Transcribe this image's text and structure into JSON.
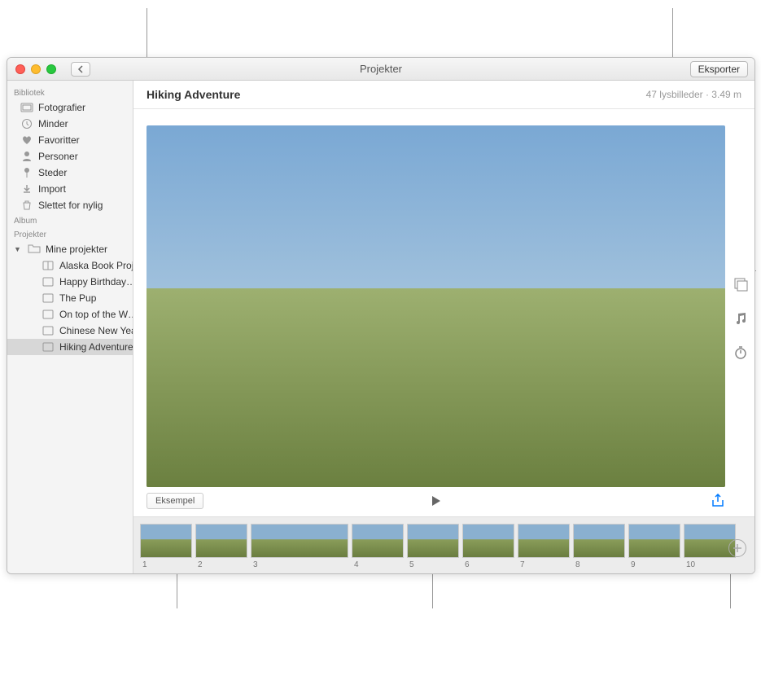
{
  "window": {
    "title": "Projekter",
    "export_label": "Eksporter"
  },
  "sidebar": {
    "sections": {
      "library_label": "Bibliotek",
      "album_label": "Album",
      "projects_label": "Projekter"
    },
    "library_items": [
      {
        "label": "Fotografier"
      },
      {
        "label": "Minder"
      },
      {
        "label": "Favoritter"
      },
      {
        "label": "Personer"
      },
      {
        "label": "Steder"
      },
      {
        "label": "Import"
      },
      {
        "label": "Slettet for nylig"
      }
    ],
    "my_projects_label": "Mine projekter",
    "project_items": [
      {
        "label": "Alaska Book Proj…"
      },
      {
        "label": "Happy Birthday…"
      },
      {
        "label": "The Pup"
      },
      {
        "label": "On top of the W…"
      },
      {
        "label": "Chinese New Year"
      },
      {
        "label": "Hiking Adventure"
      }
    ]
  },
  "main": {
    "title": "Hiking Adventure",
    "meta": "47 lysbilleder · 3.49 m",
    "preview_button": "Eksempel"
  },
  "thumbnails": [
    {
      "num": "1"
    },
    {
      "num": "2"
    },
    {
      "num": "3"
    },
    {
      "num": "4"
    },
    {
      "num": "5"
    },
    {
      "num": "6"
    },
    {
      "num": "7"
    },
    {
      "num": "8"
    },
    {
      "num": "9"
    },
    {
      "num": "10"
    }
  ]
}
